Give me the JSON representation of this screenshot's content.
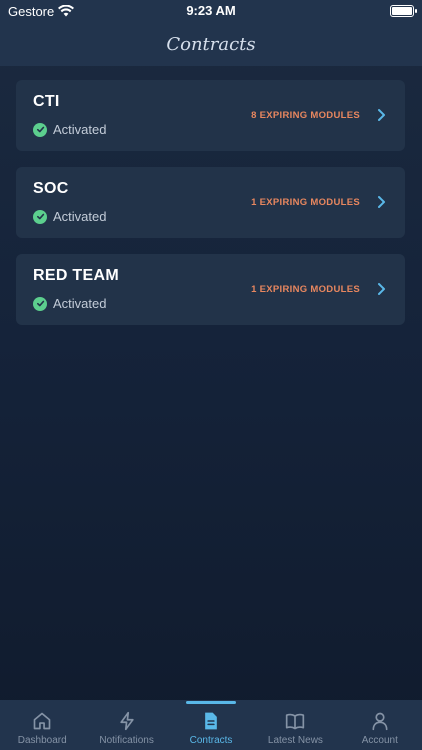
{
  "status_bar": {
    "carrier": "Gestore",
    "time": "9:23 AM"
  },
  "header": {
    "title": "Contracts"
  },
  "contracts": [
    {
      "name": "CTI",
      "status": "Activated",
      "expiring": "8 EXPIRING MODULES"
    },
    {
      "name": "SOC",
      "status": "Activated",
      "expiring": "1 EXPIRING MODULES"
    },
    {
      "name": "RED TEAM",
      "status": "Activated",
      "expiring": "1 EXPIRING MODULES"
    }
  ],
  "tab_bar": {
    "active": "Contracts",
    "tabs": [
      {
        "label": "Dashboard",
        "icon": "home-icon"
      },
      {
        "label": "Notifications",
        "icon": "lightning-icon"
      },
      {
        "label": "Contracts",
        "icon": "document-icon"
      },
      {
        "label": "Latest News",
        "icon": "book-icon"
      },
      {
        "label": "Account",
        "icon": "user-icon"
      }
    ]
  },
  "colors": {
    "accent": "#5ab8e8",
    "expiring": "#e8875f",
    "activated": "#5ccf8e",
    "card": "#223349"
  }
}
